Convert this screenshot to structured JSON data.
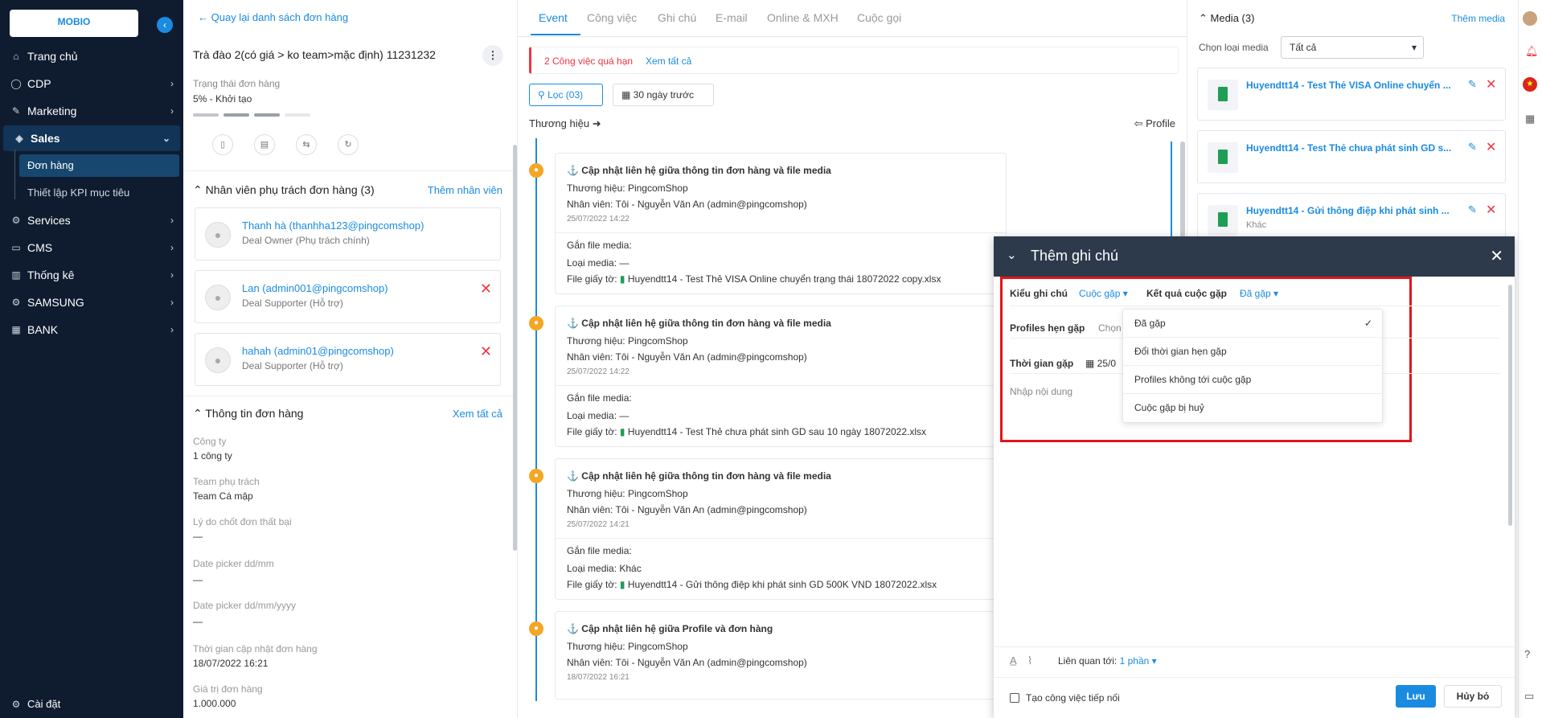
{
  "sidebar": {
    "logo": "MOBIO",
    "collapse_icon": "‹",
    "items": [
      {
        "label": "Trang chủ",
        "icon": "⌂"
      },
      {
        "label": "CDP",
        "icon": "◯"
      },
      {
        "label": "Marketing",
        "icon": "✎"
      },
      {
        "label": "Sales",
        "icon": "◈"
      },
      {
        "label": "Services",
        "icon": "⚙"
      },
      {
        "label": "CMS",
        "icon": "▭"
      },
      {
        "label": "Thống kê",
        "icon": "▥"
      },
      {
        "label": "SAMSUNG",
        "icon": "⚙"
      },
      {
        "label": "BANK",
        "icon": "▦"
      }
    ],
    "sub_items": [
      {
        "label": "Đơn hàng"
      },
      {
        "label": "Thiết lập KPI mục tiêu"
      }
    ],
    "settings": "Cài đặt"
  },
  "order": {
    "back": "Quay lại danh sách đơn hàng",
    "title": "Trà đào 2(có giá > ko team>mặc định) 11231232",
    "status_label": "Trạng thái đơn hàng",
    "status_value": "5% - Khởi tạo",
    "staff_header": "Nhân viên phụ trách đơn hàng (3)",
    "add_staff": "Thêm nhân viên",
    "staff": [
      {
        "name": "Thanh hà (thanhha123@pingcomshop)",
        "role": "Deal Owner (Phụ trách chính)"
      },
      {
        "name": "Lan (admin001@pingcomshop)",
        "role": "Deal Supporter (Hỗ trợ)"
      },
      {
        "name": "hahah (admin01@pingcomshop)",
        "role": "Deal Supporter (Hỗ trợ)"
      }
    ],
    "info_header": "Thông tin đơn hàng",
    "see_all": "Xem tất cả",
    "fields": [
      {
        "label": "Công ty",
        "value": "1 công ty"
      },
      {
        "label": "Team phụ trách",
        "value": "Team Cá mập"
      },
      {
        "label": "Lý do chốt đơn thất bại",
        "value": "—"
      },
      {
        "label": "Date picker dd/mm",
        "value": "—"
      },
      {
        "label": "Date picker dd/mm/yyyy",
        "value": "—"
      },
      {
        "label": "Thời gian cập nhật đơn hàng",
        "value": "18/07/2022 16:21"
      },
      {
        "label": "Giá trị đơn hàng",
        "value": "1.000.000"
      }
    ]
  },
  "tabs": [
    "Event",
    "Công việc",
    "Ghi chú",
    "E-mail",
    "Online & MXH",
    "Cuộc gọi"
  ],
  "alert": {
    "text": "2 Công việc quá hạn",
    "link": "Xem tất cả"
  },
  "filter": {
    "label": "Lọc (03)",
    "date": "30 ngày trước"
  },
  "timeline": {
    "brand_label": "Thương hiệu",
    "profile_label": "Profile",
    "events": [
      {
        "title": "Cập nhật liên hệ giữa thông tin đơn hàng và file media",
        "brand": "Thương hiệu:  PingcomShop",
        "staff": "Nhân viên:  Tôi - Nguyễn Văn An (admin@pingcomshop)",
        "time": "25/07/2022 14:22",
        "media_label": "Gắn file media:",
        "type": "Loại media: —",
        "file": "File giấy tờ:",
        "file_name": "Huyendtt14 - Test Thẻ VISA Online chuyển trạng thái 18072022 copy.xlsx"
      },
      {
        "title": "Cập nhật liên hệ giữa thông tin đơn hàng và file media",
        "brand": "Thương hiệu:  PingcomShop",
        "staff": "Nhân viên:  Tôi - Nguyễn Văn An (admin@pingcomshop)",
        "time": "25/07/2022 14:22",
        "media_label": "Gắn file media:",
        "type": "Loại media: —",
        "file": "File giấy tờ:",
        "file_name": "Huyendtt14 - Test Thẻ chưa phát sinh GD sau 10 ngày 18072022.xlsx"
      },
      {
        "title": "Cập nhật liên hệ giữa thông tin đơn hàng và file media",
        "brand": "Thương hiệu:  PingcomShop",
        "staff": "Nhân viên:  Tôi - Nguyễn Văn An (admin@pingcomshop)",
        "time": "25/07/2022 14:21",
        "media_label": "Gắn file media:",
        "type": "Loại media: Khác",
        "file": "File giấy tờ:",
        "file_name": "Huyendtt14 - Gửi thông điệp khi phát sinh GD 500K VND 18072022.xlsx"
      },
      {
        "title": "Cập nhật liên hệ giữa Profile và đơn hàng",
        "brand": "Thương hiệu:  PingcomShop",
        "staff": "Nhân viên:  Tôi - Nguyễn Văn An (admin@pingcomshop)",
        "time": "18/07/2022 16:21"
      }
    ]
  },
  "media": {
    "header": "Media (3)",
    "add": "Thêm media",
    "type_label": "Chọn loại media",
    "type_value": "Tất cả",
    "items": [
      {
        "name": "Huyendtt14 - Test Thẻ VISA Online chuyển ...",
        "sub": ""
      },
      {
        "name": "Huyendtt14 - Test Thẻ chưa phát sinh GD s...",
        "sub": ""
      },
      {
        "name": "Huyendtt14 - Gửi thông điệp khi phát sinh ...",
        "sub": "Khác"
      }
    ]
  },
  "note": {
    "title": "Thêm ghi chú",
    "type_label": "Kiểu ghi chú",
    "type_value": "Cuộc gặp",
    "result_label": "Kết quả cuộc gặp",
    "result_value": "Đã gặp",
    "profiles_label": "Profiles hẹn gặp",
    "profiles_placeholder": "Chọn",
    "time_label": "Thời gian gặp",
    "time_value": "25/0",
    "content_placeholder": "Nhập nội dung",
    "dropdown": [
      "Đã gặp",
      "Đổi thời gian hẹn gặp",
      "Profiles không tới cuộc gặp",
      "Cuộc gặp bị huỷ"
    ],
    "related_label": "Liên quan tới:",
    "related_value": "1 phần",
    "followup": "Tạo công việc tiếp nối",
    "save": "Lưu",
    "cancel": "Hủy bỏ"
  },
  "colors": {
    "accent": "#1a8be0",
    "sidebar": "#0f1c30",
    "alert": "#e34",
    "highlight": "#e3151a"
  }
}
